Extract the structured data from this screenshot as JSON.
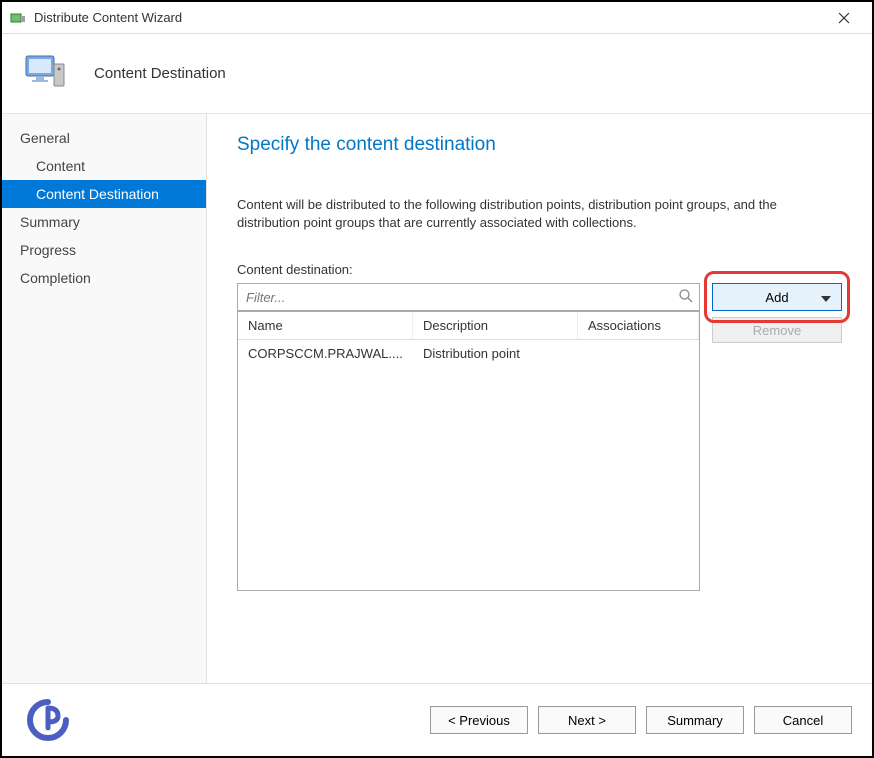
{
  "titlebar": {
    "text": "Distribute Content Wizard"
  },
  "header": {
    "title": "Content Destination"
  },
  "sidebar": {
    "items": [
      {
        "label": "General",
        "sub": false,
        "active": false
      },
      {
        "label": "Content",
        "sub": true,
        "active": false
      },
      {
        "label": "Content Destination",
        "sub": true,
        "active": true
      },
      {
        "label": "Summary",
        "sub": false,
        "active": false
      },
      {
        "label": "Progress",
        "sub": false,
        "active": false
      },
      {
        "label": "Completion",
        "sub": false,
        "active": false
      }
    ]
  },
  "main": {
    "page_title": "Specify the content destination",
    "description": "Content will be distributed to the following distribution points, distribution point groups, and the distribution point groups that are currently associated with collections.",
    "cd_label": "Content destination:",
    "filter_placeholder": "Filter...",
    "add_label": "Add",
    "remove_label": "Remove",
    "columns": {
      "c1": "Name",
      "c2": "Description",
      "c3": "Associations"
    },
    "rows": [
      {
        "name": "CORPSCCM.PRAJWAL....",
        "desc": "Distribution point",
        "assoc": ""
      }
    ]
  },
  "footer": {
    "previous": "< Previous",
    "next": "Next >",
    "summary": "Summary",
    "cancel": "Cancel"
  }
}
